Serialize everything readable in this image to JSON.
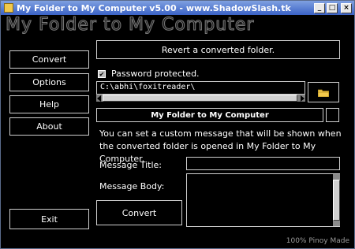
{
  "window": {
    "title": "My Folder to My Computer v5.00 - www.ShadowSlash.tk",
    "banner": "My Folder to My Computer"
  },
  "titlebar_buttons": {
    "minimize": "_",
    "maximize": "□",
    "close": "×"
  },
  "sidebar": {
    "items": [
      {
        "label": "Convert"
      },
      {
        "label": "Options"
      },
      {
        "label": "Help"
      },
      {
        "label": "About"
      }
    ],
    "exit_label": "Exit"
  },
  "main": {
    "revert_label": "Revert a converted folder.",
    "password_label": "Password protected.",
    "password_checked": true,
    "path_value": "C:\\abhi\\foxitreader\\",
    "folder_icon": "folder-icon",
    "heading": "My Folder to My Computer",
    "description": "You can set a custom message that will be shown when the converted folder is opened in My Folder to My Computer.",
    "message_title_label": "Message Title:",
    "message_title_value": "",
    "message_body_label": "Message Body:",
    "message_body_value": "",
    "convert_label": "Convert"
  },
  "footer": "100% Pinoy Made"
}
